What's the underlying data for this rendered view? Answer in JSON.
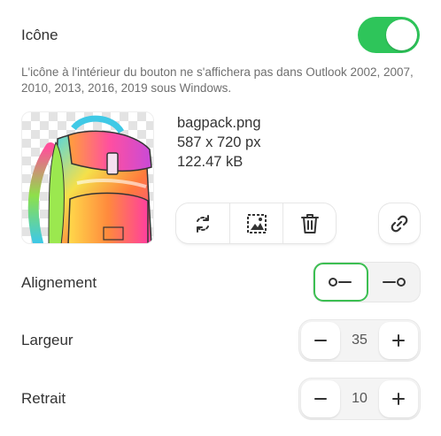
{
  "icon_section": {
    "label": "Icône",
    "enabled": true,
    "note": "L'icône à l'intérieur du bouton ne s'affichera pas dans Outlook 2002, 2007, 2010, 2013, 2016, 2019 sous Windows."
  },
  "file": {
    "name": "bagpack.png",
    "dimensions": "587 x 720 px",
    "size": "122.47 kB"
  },
  "actions": {
    "icons": [
      "replace-icon",
      "image-edit-icon",
      "trash-icon",
      "link-icon"
    ]
  },
  "alignment": {
    "label": "Alignement",
    "options": [
      "icon-left",
      "icon-right"
    ],
    "selected": "icon-left"
  },
  "width": {
    "label": "Largeur",
    "value": "35"
  },
  "indent": {
    "label": "Retrait",
    "value": "10"
  },
  "colors": {
    "accent": "#2ec55a",
    "selected_border": "#3cbf52"
  }
}
